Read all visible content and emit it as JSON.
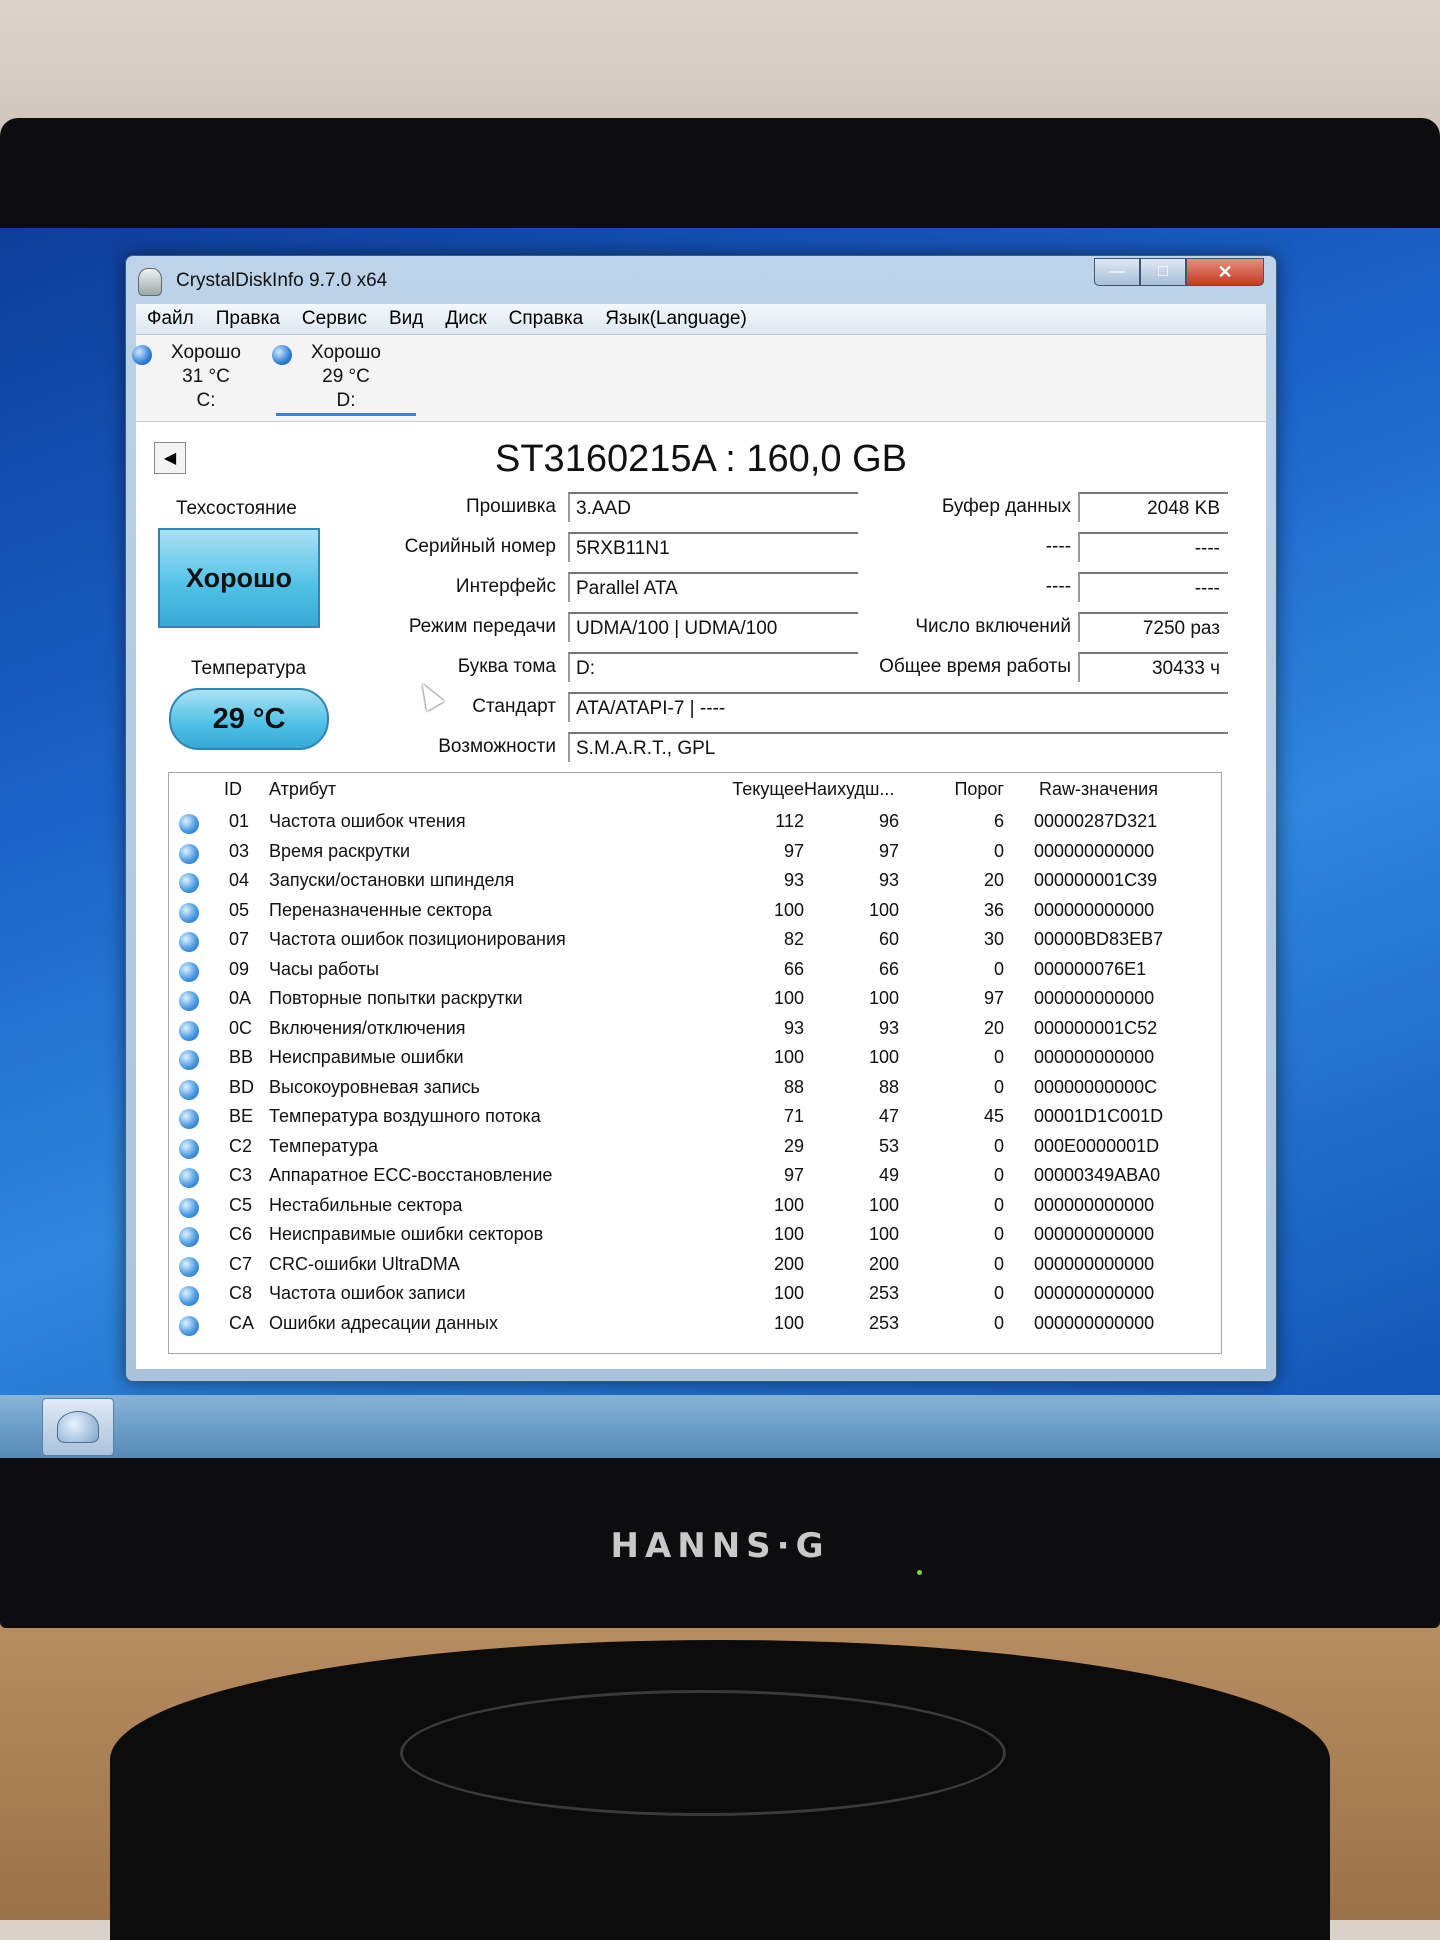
{
  "window": {
    "title": "CrystalDiskInfo 9.7.0 x64"
  },
  "menu": [
    "Файл",
    "Правка",
    "Сервис",
    "Вид",
    "Диск",
    "Справка",
    "Язык(Language)"
  ],
  "drives": [
    {
      "status": "Хорошо",
      "temp": "31 °C",
      "letter": "C:"
    },
    {
      "status": "Хорошо",
      "temp": "29 °C",
      "letter": "D:"
    }
  ],
  "model": "ST3160215A : 160,0 GB",
  "health": {
    "label": "Техсостояние",
    "value": "Хорошо"
  },
  "temperature": {
    "label": "Температура",
    "value": "29 °C"
  },
  "info": {
    "firmware_label": "Прошивка",
    "firmware": "3.AAD",
    "serial_label": "Серийный номер",
    "serial": "5RXB11N1",
    "interface_label": "Интерфейс",
    "interface": "Parallel ATA",
    "transfer_label": "Режим передачи",
    "transfer": "UDMA/100 | UDMA/100",
    "volume_label": "Буква тома",
    "volume": "D:",
    "standard_label": "Стандарт",
    "standard": "ATA/ATAPI-7 | ----",
    "features_label": "Возможности",
    "features": "S.M.A.R.T., GPL",
    "buffer_label": "Буфер данных",
    "buffer": "2048 KB",
    "r2_label": "----",
    "r2": "----",
    "r3_label": "----",
    "r3": "----",
    "power_count_label": "Число включений",
    "power_count": "7250 раз",
    "power_hours_label": "Общее время работы",
    "power_hours": "30433 ч"
  },
  "smart": {
    "headers": {
      "id": "ID",
      "attr": "Атрибут",
      "cur": "Текущее",
      "worst": "Наихудш...",
      "thr": "Порог",
      "raw": "Raw-значения"
    },
    "rows": [
      {
        "id": "01",
        "attr": "Частота ошибок чтения",
        "cur": "112",
        "worst": "96",
        "thr": "6",
        "raw": "00000287D321"
      },
      {
        "id": "03",
        "attr": "Время раскрутки",
        "cur": "97",
        "worst": "97",
        "thr": "0",
        "raw": "000000000000"
      },
      {
        "id": "04",
        "attr": "Запуски/остановки шпинделя",
        "cur": "93",
        "worst": "93",
        "thr": "20",
        "raw": "000000001C39"
      },
      {
        "id": "05",
        "attr": "Переназначенные сектора",
        "cur": "100",
        "worst": "100",
        "thr": "36",
        "raw": "000000000000"
      },
      {
        "id": "07",
        "attr": "Частота ошибок позиционирования",
        "cur": "82",
        "worst": "60",
        "thr": "30",
        "raw": "00000BD83EB7"
      },
      {
        "id": "09",
        "attr": "Часы работы",
        "cur": "66",
        "worst": "66",
        "thr": "0",
        "raw": "000000076E1"
      },
      {
        "id": "0A",
        "attr": "Повторные попытки раскрутки",
        "cur": "100",
        "worst": "100",
        "thr": "97",
        "raw": "000000000000"
      },
      {
        "id": "0C",
        "attr": "Включения/отключения",
        "cur": "93",
        "worst": "93",
        "thr": "20",
        "raw": "000000001C52"
      },
      {
        "id": "BB",
        "attr": "Неисправимые ошибки",
        "cur": "100",
        "worst": "100",
        "thr": "0",
        "raw": "000000000000"
      },
      {
        "id": "BD",
        "attr": "Высокоуровневая запись",
        "cur": "88",
        "worst": "88",
        "thr": "0",
        "raw": "00000000000C"
      },
      {
        "id": "BE",
        "attr": "Температура воздушного потока",
        "cur": "71",
        "worst": "47",
        "thr": "45",
        "raw": "00001D1C001D"
      },
      {
        "id": "C2",
        "attr": "Температура",
        "cur": "29",
        "worst": "53",
        "thr": "0",
        "raw": "000E0000001D"
      },
      {
        "id": "C3",
        "attr": "Аппаратное ECC-восстановление",
        "cur": "97",
        "worst": "49",
        "thr": "0",
        "raw": "00000349ABA0"
      },
      {
        "id": "C5",
        "attr": "Нестабильные сектора",
        "cur": "100",
        "worst": "100",
        "thr": "0",
        "raw": "000000000000"
      },
      {
        "id": "C6",
        "attr": "Неисправимые ошибки секторов",
        "cur": "100",
        "worst": "100",
        "thr": "0",
        "raw": "000000000000"
      },
      {
        "id": "C7",
        "attr": "CRC-ошибки UltraDMA",
        "cur": "200",
        "worst": "200",
        "thr": "0",
        "raw": "000000000000"
      },
      {
        "id": "C8",
        "attr": "Частота ошибок записи",
        "cur": "100",
        "worst": "253",
        "thr": "0",
        "raw": "000000000000"
      },
      {
        "id": "CA",
        "attr": "Ошибки адресации данных",
        "cur": "100",
        "worst": "253",
        "thr": "0",
        "raw": "000000000000"
      }
    ]
  },
  "monitor": {
    "brand": "HANNS·G"
  },
  "colors": {
    "good": "#4fc0e6",
    "accent": "#2f86b4",
    "desktop": "#1b63c9"
  }
}
